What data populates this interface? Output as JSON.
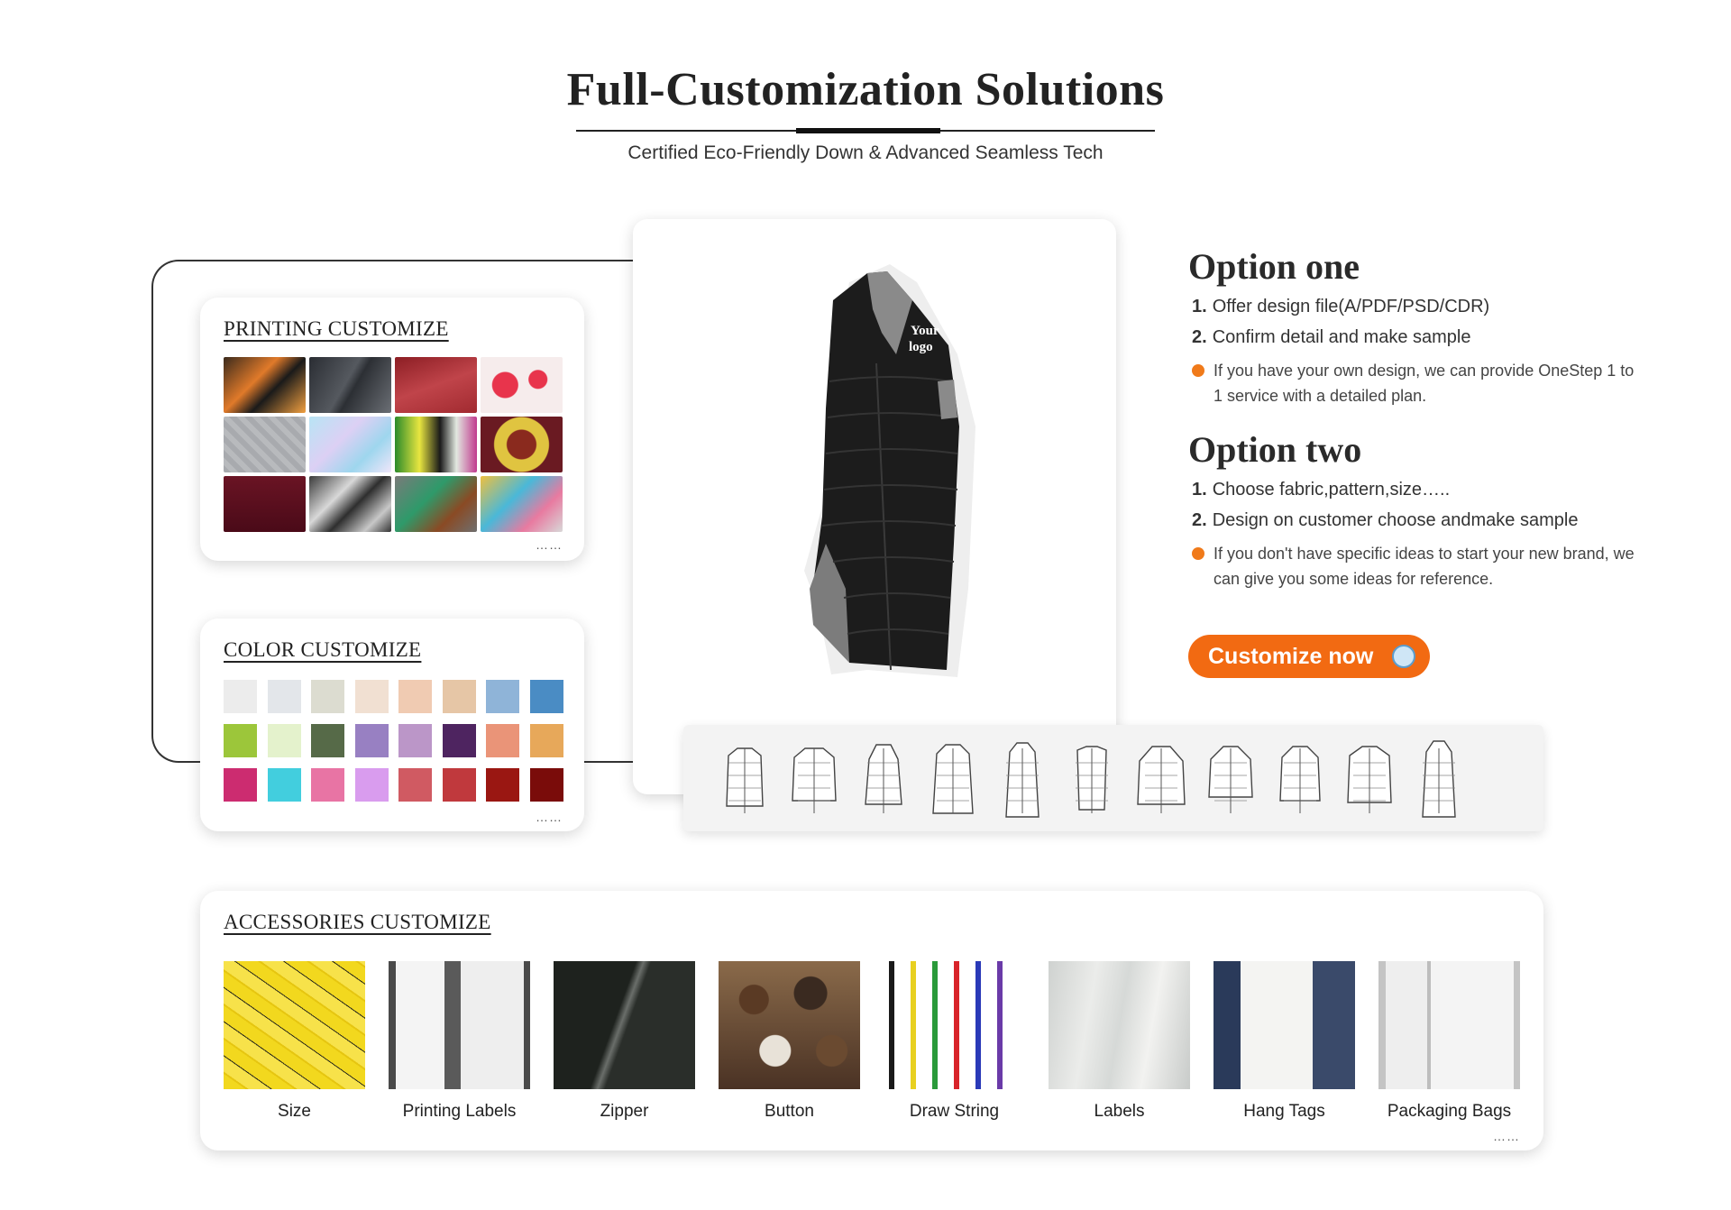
{
  "header": {
    "title": "Full-Customization Solutions",
    "subtitle": "Certified Eco-Friendly Down & Advanced Seamless Tech"
  },
  "printing": {
    "title": "PRINTING CUSTOMIZE",
    "more": "……"
  },
  "color": {
    "title": "COLOR CUSTOMIZE",
    "more": "……",
    "swatches": [
      "#ececec",
      "#e3e6ea",
      "#dcdcd0",
      "#f1e0d2",
      "#f0cbb2",
      "#e6c6a6",
      "#8fb4d8",
      "#4a8cc4",
      "#9cc63a",
      "#e4f2cc",
      "#566a48",
      "#9880c2",
      "#bb96c8",
      "#4e2460",
      "#ea9478",
      "#e7a85a",
      "#cc2c70",
      "#42cede",
      "#e874a4",
      "#d99cee",
      "#d05a62",
      "#c0393d",
      "#9a1712",
      "#7a0c0a"
    ]
  },
  "product": {
    "logo_text_1": "Your",
    "logo_text_2": "logo"
  },
  "options": {
    "one": {
      "title": "Option one",
      "step1_num": "1.",
      "step1": "Offer design file(A/PDF/PSD/CDR)",
      "step2_num": "2.",
      "step2": "Confirm detail and make sample",
      "note": "If you have your own design, we can provide OneStep 1 to 1 service with a detailed plan."
    },
    "two": {
      "title": "Option two",
      "step1_num": "1.",
      "step1": "Choose fabric,pattern,size…..",
      "step2_num": "2.",
      "step2": "Design on customer choose andmake sample",
      "note": "If you don't have specific ideas to start your new brand, we can give you some ideas for reference."
    },
    "cta_label": "Customize now",
    "accent": "#f26a12"
  },
  "accessories": {
    "title": "ACCESSORIES CUSTOMIZE",
    "more": "……",
    "items": [
      {
        "label": "Size"
      },
      {
        "label": "Printing Labels"
      },
      {
        "label": "Zipper"
      },
      {
        "label": "Button"
      },
      {
        "label": "Draw String"
      },
      {
        "label": "Labels"
      },
      {
        "label": "Hang Tags"
      },
      {
        "label": "Packaging Bags"
      }
    ]
  }
}
